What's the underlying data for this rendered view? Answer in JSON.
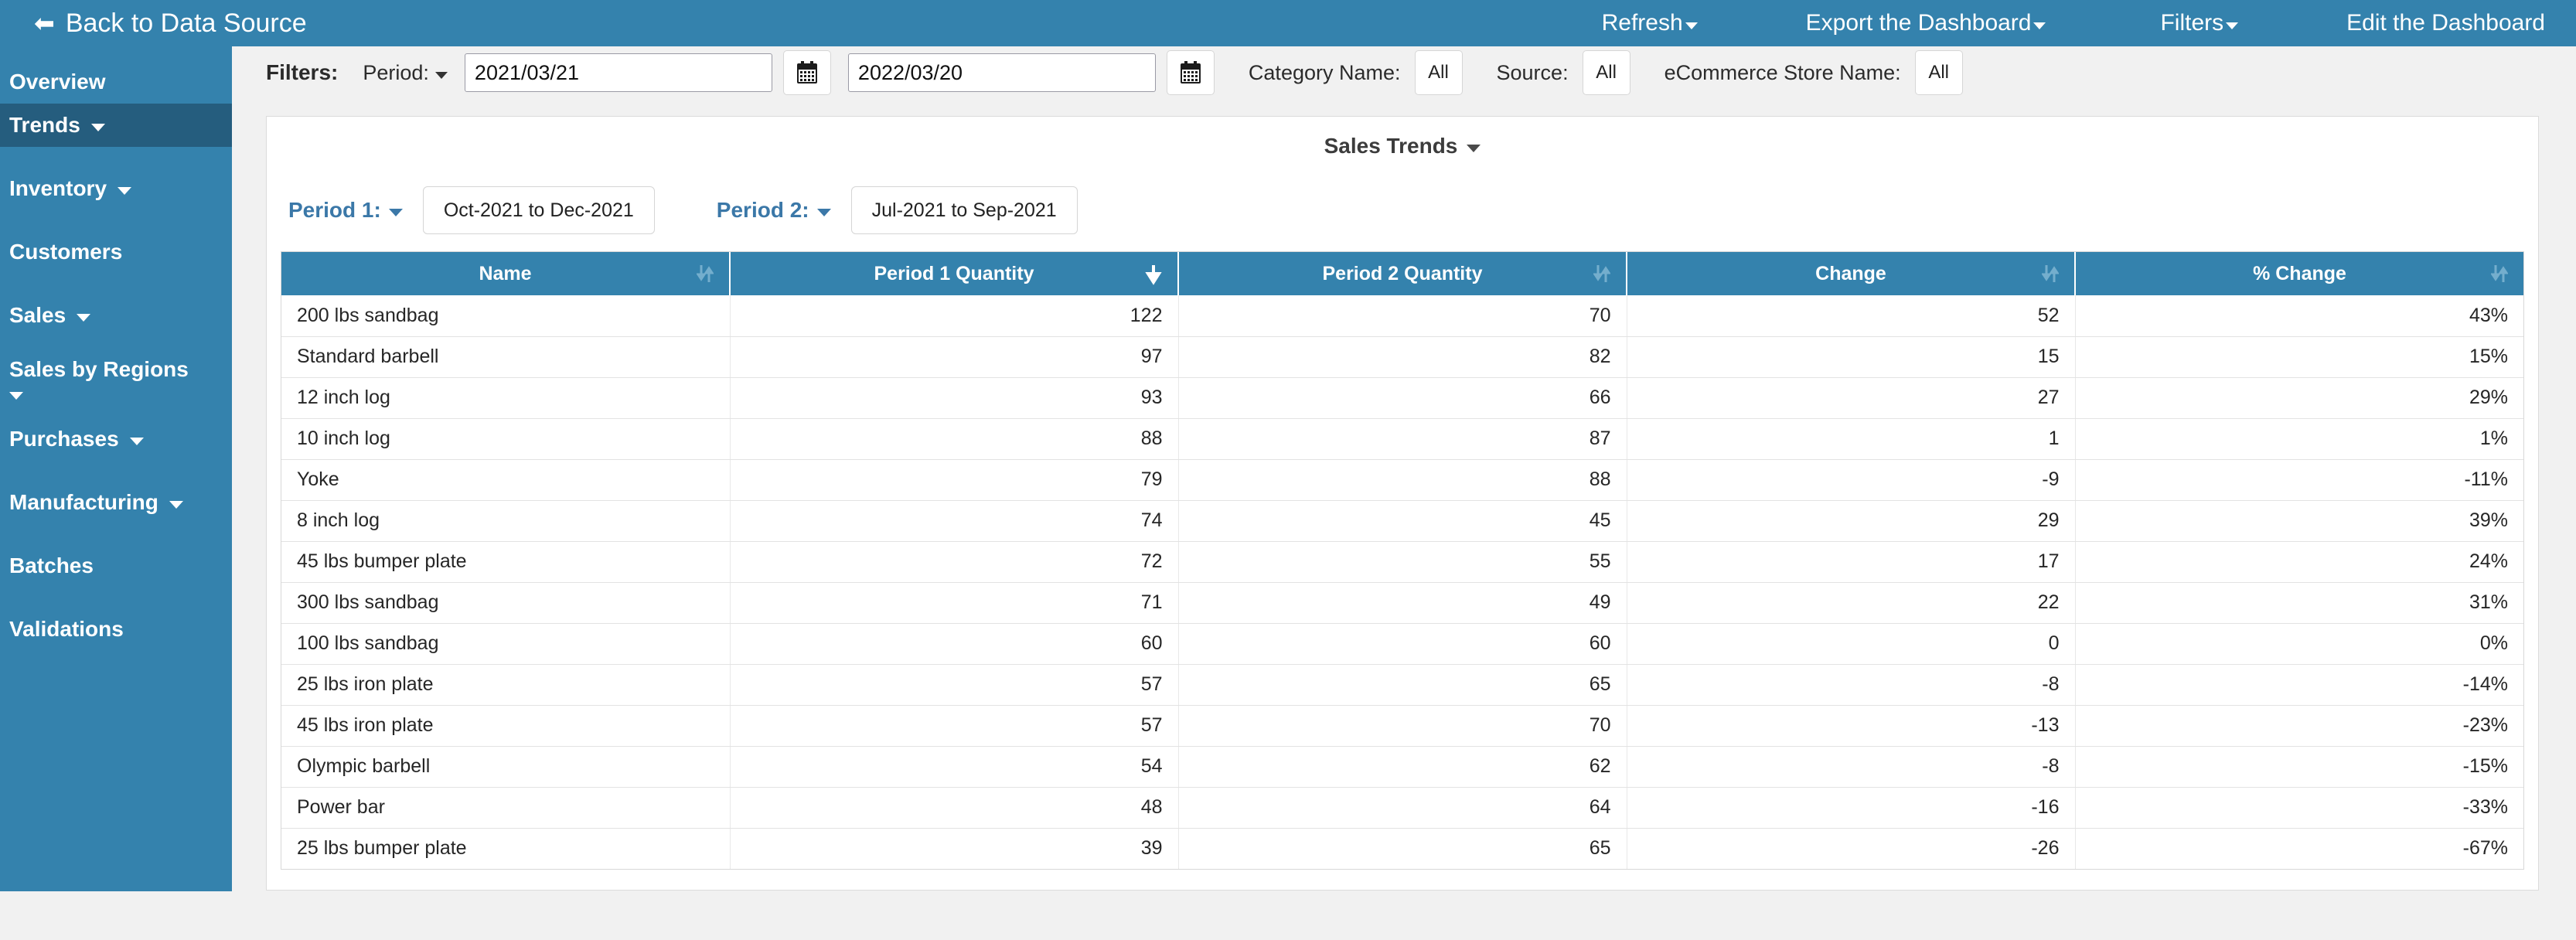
{
  "topbar": {
    "back_label": "Back to Data Source",
    "back_icon": "arrow-left-icon",
    "menus": [
      {
        "label": "Refresh",
        "has_caret": true
      },
      {
        "label": "Export the Dashboard",
        "has_caret": true
      },
      {
        "label": "Filters",
        "has_caret": true
      },
      {
        "label": "Edit the Dashboard",
        "has_caret": false
      }
    ]
  },
  "sidebar": {
    "items": [
      {
        "label": "Overview",
        "caret": false,
        "active": false
      },
      {
        "label": "Trends",
        "caret": true,
        "active": true
      },
      {
        "label": "Inventory",
        "caret": true,
        "active": false
      },
      {
        "label": "Customers",
        "caret": false,
        "active": false
      },
      {
        "label": "Sales",
        "caret": true,
        "active": false
      },
      {
        "label": "Sales by Regions",
        "caret": true,
        "active": false
      },
      {
        "label": "Purchases",
        "caret": true,
        "active": false
      },
      {
        "label": "Manufacturing",
        "caret": true,
        "active": false
      },
      {
        "label": "Batches",
        "caret": false,
        "active": false
      },
      {
        "label": "Validations",
        "caret": false,
        "active": false
      }
    ]
  },
  "filterbar": {
    "filters_label": "Filters:",
    "period_label": "Period:",
    "date_from": "2021/03/21",
    "date_to": "2022/03/20",
    "calendar_icon": "calendar-icon",
    "category_label": "Category Name:",
    "category_value": "All",
    "source_label": "Source:",
    "source_value": "All",
    "store_label": "eCommerce Store Name:",
    "store_value": "All"
  },
  "card": {
    "title": "Sales Trends",
    "period1_label": "Period 1:",
    "period1_value": "Oct-2021 to Dec-2021",
    "period2_label": "Period 2:",
    "period2_value": "Jul-2021 to Sep-2021"
  },
  "colors": {
    "brand_blue": "#3482ad",
    "active_blue": "#255d7e",
    "link_blue": "#3b78a8",
    "page_bg": "#f1f1f1"
  },
  "chart_data": {
    "type": "table",
    "title": "Sales Trends",
    "columns": [
      {
        "label": "Name",
        "align": "left",
        "sort": "both"
      },
      {
        "label": "Period 1 Quantity",
        "align": "right",
        "sort": "desc"
      },
      {
        "label": "Period 2 Quantity",
        "align": "right",
        "sort": "both"
      },
      {
        "label": "Change",
        "align": "right",
        "sort": "both"
      },
      {
        "label": "% Change",
        "align": "right",
        "sort": "both"
      }
    ],
    "rows": [
      {
        "name": "200 lbs sandbag",
        "p1": "122",
        "p2": "70",
        "change": "52",
        "pct": "43%"
      },
      {
        "name": "Standard barbell",
        "p1": "97",
        "p2": "82",
        "change": "15",
        "pct": "15%"
      },
      {
        "name": "12 inch log",
        "p1": "93",
        "p2": "66",
        "change": "27",
        "pct": "29%"
      },
      {
        "name": "10 inch log",
        "p1": "88",
        "p2": "87",
        "change": "1",
        "pct": "1%"
      },
      {
        "name": "Yoke",
        "p1": "79",
        "p2": "88",
        "change": "-9",
        "pct": "-11%"
      },
      {
        "name": "8 inch log",
        "p1": "74",
        "p2": "45",
        "change": "29",
        "pct": "39%"
      },
      {
        "name": "45 lbs bumper plate",
        "p1": "72",
        "p2": "55",
        "change": "17",
        "pct": "24%"
      },
      {
        "name": "300 lbs sandbag",
        "p1": "71",
        "p2": "49",
        "change": "22",
        "pct": "31%"
      },
      {
        "name": "100 lbs sandbag",
        "p1": "60",
        "p2": "60",
        "change": "0",
        "pct": "0%"
      },
      {
        "name": "25 lbs iron plate",
        "p1": "57",
        "p2": "65",
        "change": "-8",
        "pct": "-14%"
      },
      {
        "name": "45 lbs iron plate",
        "p1": "57",
        "p2": "70",
        "change": "-13",
        "pct": "-23%"
      },
      {
        "name": "Olympic barbell",
        "p1": "54",
        "p2": "62",
        "change": "-8",
        "pct": "-15%"
      },
      {
        "name": "Power bar",
        "p1": "48",
        "p2": "64",
        "change": "-16",
        "pct": "-33%"
      },
      {
        "name": "25 lbs bumper plate",
        "p1": "39",
        "p2": "65",
        "change": "-26",
        "pct": "-67%"
      }
    ]
  }
}
